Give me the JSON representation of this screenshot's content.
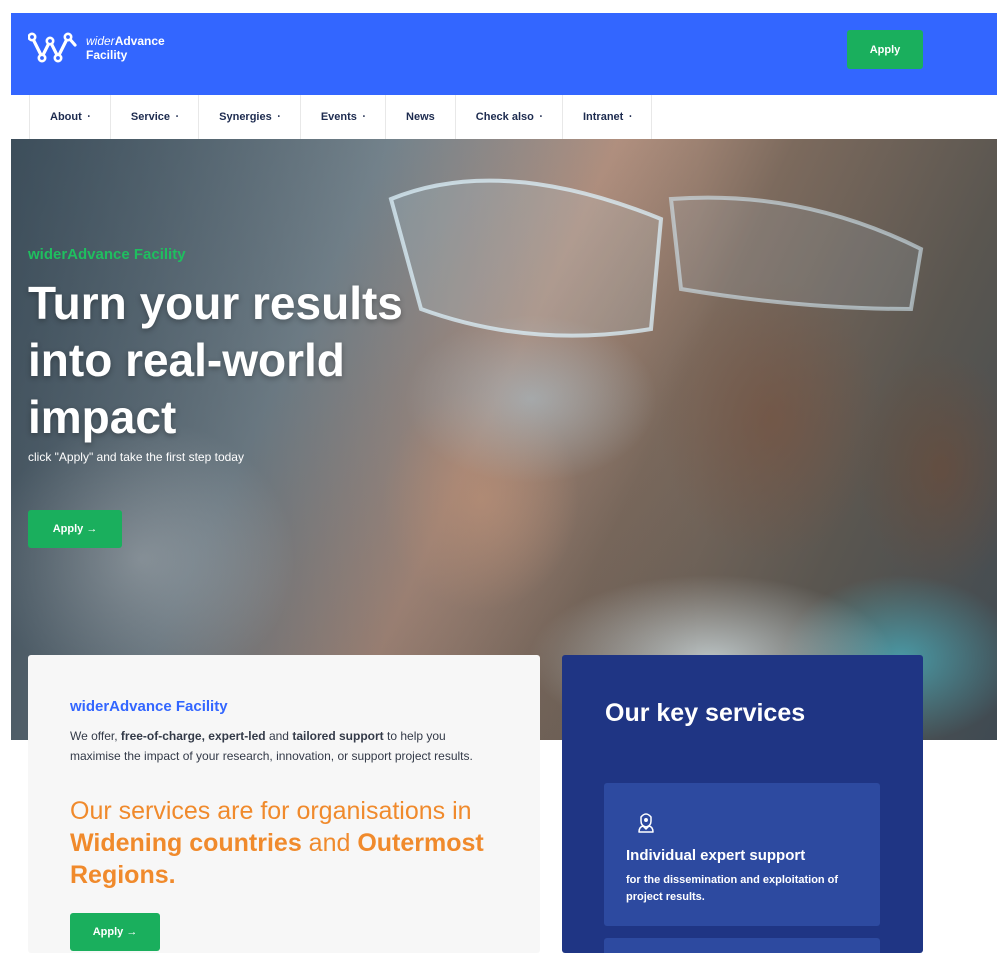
{
  "colors": {
    "header_bg": "#3366ff",
    "button_green": "#1aaf5d",
    "eyebrow_green": "#1fbf5f",
    "accent_orange": "#f08a2c",
    "panel_blue": "#1f3584",
    "card_blue": "#2d4aa0"
  },
  "header": {
    "logo_line1_light": "wider",
    "logo_line1_bold": "Advance",
    "logo_line2": "Facility",
    "apply_label": "Apply"
  },
  "nav": {
    "items": [
      {
        "label": "About",
        "has_dropdown": true
      },
      {
        "label": "Service",
        "has_dropdown": true
      },
      {
        "label": "Synergies",
        "has_dropdown": true
      },
      {
        "label": "Events",
        "has_dropdown": true
      },
      {
        "label": "News",
        "has_dropdown": false
      },
      {
        "label": "Check also",
        "has_dropdown": true
      },
      {
        "label": "Intranet",
        "has_dropdown": true
      }
    ]
  },
  "hero": {
    "eyebrow": "widerAdvance Facility",
    "title": "Turn your results into real-world impact",
    "subtitle": "click \"Apply\" and take the first step today",
    "apply_label": "Apply"
  },
  "intro_card": {
    "title": "widerAdvance Facility",
    "text_parts": {
      "p1": "We offer, ",
      "b1": "free-of-charge, expert-led",
      "p2": " and ",
      "b2": "tailored support",
      "p3": " to help you maximise the impact of your research, innovation, or support project results."
    },
    "heading_parts": {
      "h1": "Our services are for organisations in ",
      "hb1": "Widening countries",
      "h2": " and ",
      "hb2": "Outermost Regions."
    },
    "apply_label": "Apply"
  },
  "services_panel": {
    "title": "Our key services",
    "services": [
      {
        "icon": "expert-icon",
        "title": "Individual expert support",
        "description": "for the dissemination and exploitation of project results."
      }
    ]
  }
}
